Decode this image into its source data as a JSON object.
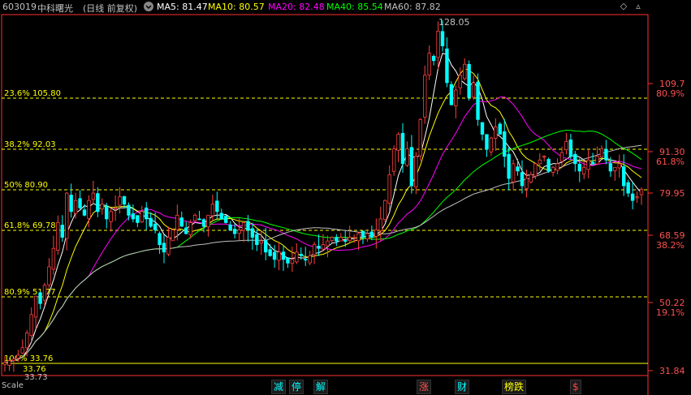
{
  "header": {
    "code": "603019",
    "name": "中科曙光",
    "mode": "(日线 前复权)",
    "dropdown_icon": "chevron-down-icon",
    "ma": [
      {
        "label": "MA5: 81.47",
        "color": "#ffffff"
      },
      {
        "label": "MA10: 80.57",
        "color": "#ffff00"
      },
      {
        "label": "MA20: 82.48",
        "color": "#ff00ff"
      },
      {
        "label": "MA40: 85.54",
        "color": "#00ff00"
      },
      {
        "label": "MA60: 87.82",
        "color": "#c0c0c0"
      }
    ],
    "controls": [
      "expand-icon",
      "collapse-icon"
    ]
  },
  "chart_data": {
    "type": "candlestick",
    "price_range": [
      31.84,
      128.05
    ],
    "high_label": "128.05",
    "low_label": "33.73",
    "low_label2": "33.76",
    "fib_levels": [
      {
        "label": "23.6% 105.80",
        "value": 105.8
      },
      {
        "label": "38.2% 92.03",
        "value": 92.03
      },
      {
        "label": "50% 80.90",
        "value": 80.9
      },
      {
        "label": "61.8% 69.78",
        "value": 69.78
      },
      {
        "label": "80.9% 51.77",
        "value": 51.77
      },
      {
        "label": "100% 33.76",
        "value": 33.76
      }
    ],
    "right_axis": [
      {
        "price": "109.7",
        "pct": "80.9%",
        "value": 109.7
      },
      {
        "price": "91.30",
        "pct": "61.8%",
        "value": 91.3
      },
      {
        "price": "79.95",
        "pct": "",
        "value": 79.95
      },
      {
        "price": "68.59",
        "pct": "38.2%",
        "value": 68.59
      },
      {
        "price": "50.22",
        "pct": "19.1%",
        "value": 50.22
      },
      {
        "price": "31.84",
        "pct": "",
        "value": 31.84
      }
    ],
    "close_series": [
      34,
      34.5,
      35,
      36,
      38,
      42,
      47,
      52,
      50,
      55,
      60,
      65,
      72,
      68,
      80,
      75,
      78,
      76,
      74,
      78,
      80,
      75,
      77,
      73,
      75,
      76,
      79,
      77,
      74,
      73,
      72,
      75,
      73,
      71,
      70,
      66,
      64,
      68,
      70,
      74,
      71,
      69,
      72,
      74,
      73,
      71,
      74,
      77,
      75,
      73,
      72,
      70,
      69,
      70,
      72,
      70,
      68,
      66,
      67,
      64,
      63,
      62,
      64,
      62,
      61,
      62,
      64,
      63,
      62,
      63,
      66,
      65,
      66,
      67,
      68,
      67,
      68,
      67,
      68,
      68,
      69,
      68,
      69,
      68,
      70,
      73,
      78,
      85,
      92,
      96,
      88,
      92,
      82,
      90,
      100,
      112,
      118,
      116,
      124,
      120,
      110,
      104,
      108,
      112,
      115,
      106,
      110,
      100,
      96,
      92,
      95,
      98,
      96,
      90,
      84,
      88,
      86,
      82,
      84,
      85,
      88,
      89,
      90,
      86,
      87,
      88,
      91,
      94,
      90,
      88,
      86,
      87,
      89,
      88,
      90,
      92,
      89,
      86,
      87,
      88,
      82,
      80,
      78,
      79,
      81
    ]
  },
  "bottom": {
    "label": "Scale  ",
    "markers": [
      {
        "text": "减",
        "color": "#00ffff"
      },
      {
        "text": "停",
        "color": "#00ffff"
      },
      {
        "text": "解",
        "color": "#00ffff"
      },
      {
        "text": "涨",
        "color": "#ff5050"
      },
      {
        "text": "财",
        "color": "#00ffff"
      },
      {
        "text": "榜跌",
        "color": "#ffff00"
      },
      {
        "text": "$",
        "color": "#ff4040"
      }
    ]
  }
}
